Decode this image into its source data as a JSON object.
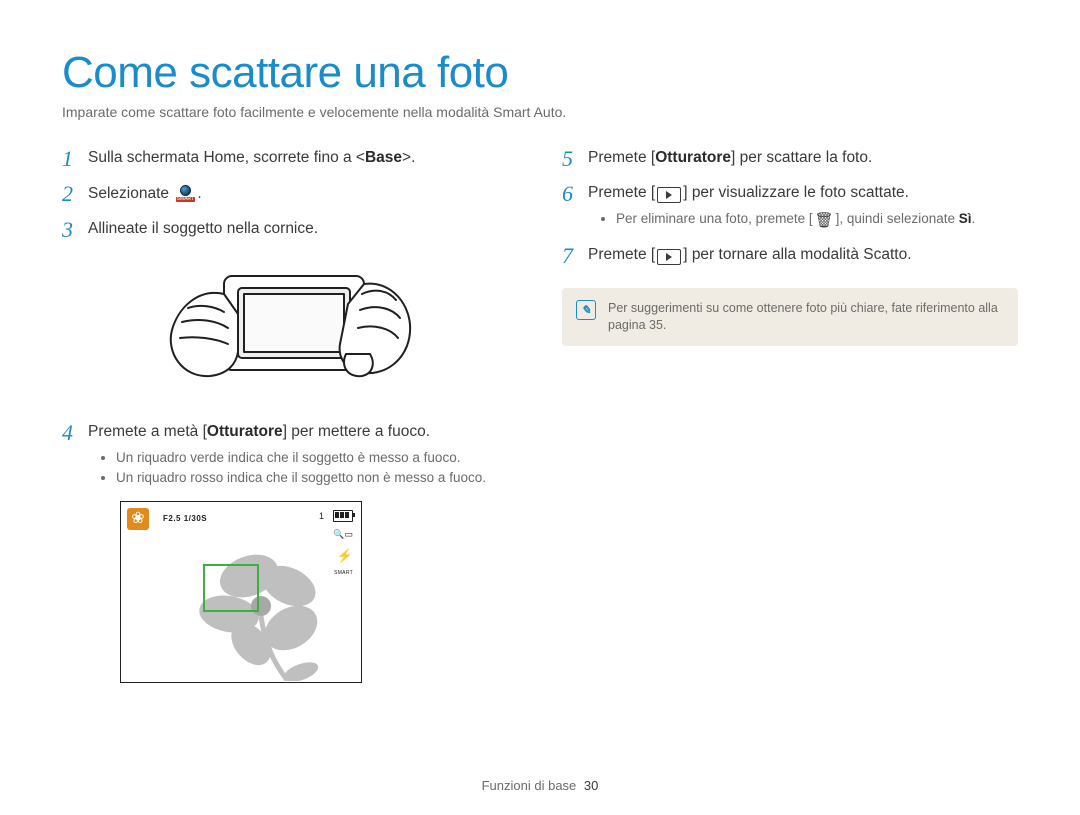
{
  "title": "Come scattare una foto",
  "subtitle": "Imparate come scattare foto facilmente e velocemente nella modalità Smart Auto.",
  "left": {
    "step1": {
      "num": "1",
      "pre": "Sulla schermata Home, scorrete fino a <",
      "bold": "Base",
      "post": ">."
    },
    "step2": {
      "num": "2",
      "text": "Selezionate "
    },
    "step3": {
      "num": "3",
      "text": "Allineate il soggetto nella cornice."
    },
    "step4": {
      "num": "4",
      "pre": "Premete a metà [",
      "bold": "Otturatore",
      "post": "] per mettere a fuoco.",
      "sub1": "Un riquadro verde indica che il soggetto è messo a fuoco.",
      "sub2": "Un riquadro rosso indica che il soggetto non è messo a fuoco."
    },
    "screen": {
      "exposure": "F2.5 1/30S",
      "count": "1",
      "smart_label": "SMART"
    }
  },
  "right": {
    "step5": {
      "num": "5",
      "pre": "Premete [",
      "bold": "Otturatore",
      "post": "] per scattare la foto."
    },
    "step6": {
      "num": "6",
      "pre": "Premete [",
      "post": "] per visualizzare le foto scattate.",
      "sub_pre": "Per eliminare una foto, premete [",
      "sub_post": "], quindi selezionate ",
      "sub_bold": "Sì",
      "sub_end": "."
    },
    "step7": {
      "num": "7",
      "pre": "Premete [",
      "post": "] per tornare alla modalità Scatto."
    },
    "tip": "Per suggerimenti su come ottenere foto più chiare, fate riferimento alla pagina 35."
  },
  "footer": {
    "section": "Funzioni di base",
    "page": "30"
  }
}
